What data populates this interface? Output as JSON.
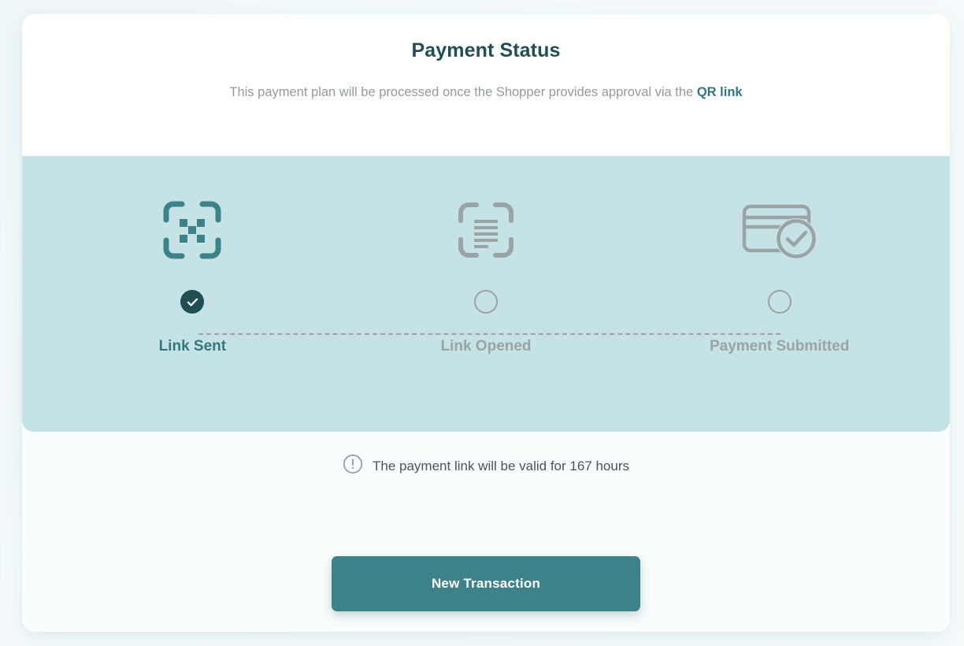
{
  "header": {
    "title": "Payment Status",
    "subtitle_prefix": "This payment plan will be processed once the Shopper provides approval via the ",
    "subtitle_link": "QR link"
  },
  "colors": {
    "brand_dark": "#1f4f53",
    "brand_teal": "#3d8288",
    "band_bg": "#c5e3e4",
    "muted": "#9aa3a5",
    "page_bg": "#f4fafb"
  },
  "steps": [
    {
      "id": "link-sent",
      "label": "Link Sent",
      "icon": "qr-scan-icon",
      "state": "done"
    },
    {
      "id": "link-opened",
      "label": "Link Opened",
      "icon": "scan-document-icon",
      "state": "pending"
    },
    {
      "id": "payment-submitted",
      "label": "Payment Submitted",
      "icon": "credit-card-check-icon",
      "state": "pending"
    }
  ],
  "notice": {
    "icon": "exclamation-circle-icon",
    "text": "The payment link will be valid for 167 hours"
  },
  "actions": {
    "primary_label": "New Transaction"
  }
}
